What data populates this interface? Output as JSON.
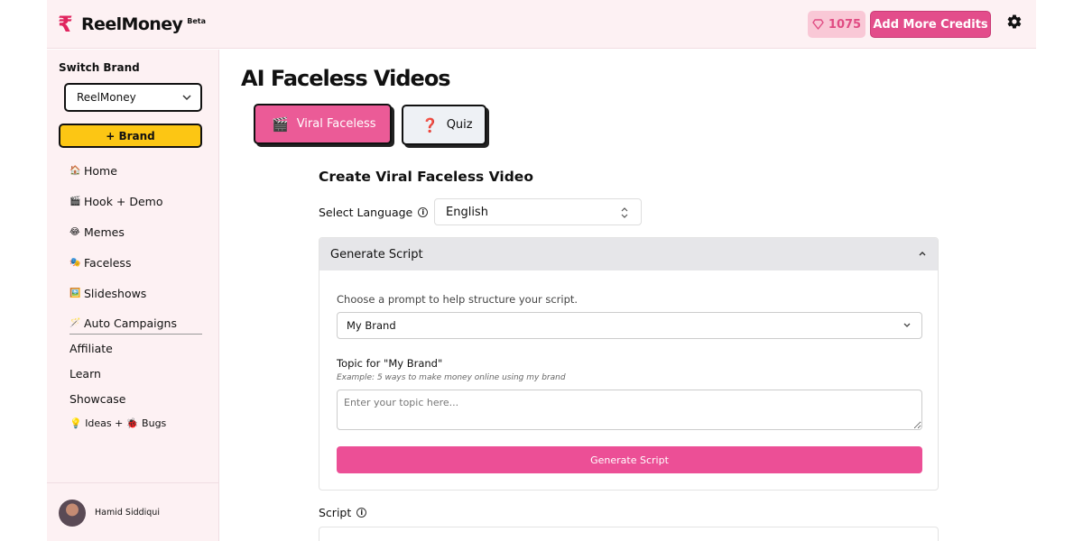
{
  "header": {
    "brand_name": "ReelMoney",
    "beta_label": "Beta",
    "logo_icon": "rupee-icon",
    "credits_count": "1075",
    "add_credits_label": "Add More Credits",
    "settings_icon": "gear-icon",
    "accent_color": "#e34d8b"
  },
  "sidebar": {
    "switch_brand_label": "Switch Brand",
    "selected_brand": "ReelMoney",
    "add_brand_label": "+ Brand",
    "items": [
      {
        "emoji": "🏠",
        "label": "Home"
      },
      {
        "emoji": "🎬",
        "label": "Hook + Demo"
      },
      {
        "emoji": "😂",
        "label": "Memes"
      },
      {
        "emoji": "🎭",
        "label": "Faceless"
      },
      {
        "emoji": "🖼️",
        "label": "Slideshows"
      },
      {
        "emoji": "🪄",
        "label": "Auto Campaigns"
      }
    ],
    "secondary_items": [
      {
        "label": "Affiliate"
      },
      {
        "label": "Learn"
      },
      {
        "label": "Showcase"
      },
      {
        "label": "💡 Ideas + 🐞 Bugs"
      }
    ],
    "user_name": "Hamid Siddiqui"
  },
  "main": {
    "page_title": "AI Faceless Videos",
    "tabs": [
      {
        "emoji": "🎬",
        "label": "Viral Faceless",
        "active": true
      },
      {
        "emoji": "❓",
        "label": "Quiz",
        "active": false
      }
    ],
    "form_title": "Create Viral Faceless Video",
    "language_label": "Select Language",
    "language_value": "English",
    "accordion": {
      "title": "Generate Script",
      "prompt_label": "Choose a prompt to help structure your script.",
      "prompt_value": "My Brand",
      "topic_label": "Topic for \"My Brand\"",
      "topic_example": "Example: 5 ways to make money online using my brand",
      "topic_placeholder": "Enter your topic here...",
      "generate_button": "Generate Script"
    },
    "script_label": "Script"
  }
}
